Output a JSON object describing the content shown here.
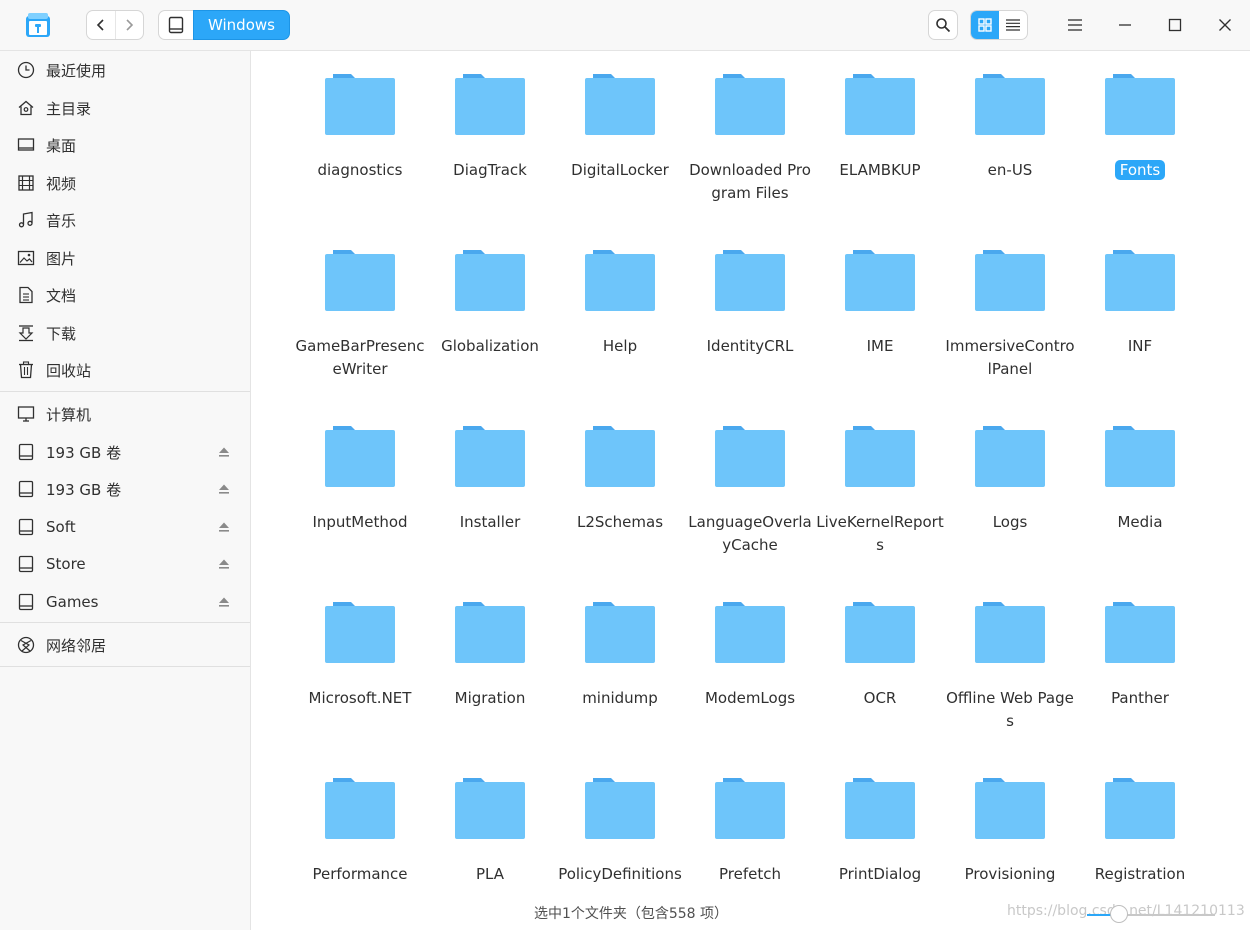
{
  "titlebar": {
    "app_icon": "file-manager-logo",
    "breadcrumb": {
      "home_icon": "drive-icon",
      "current": "Windows"
    },
    "view_mode": "icon-view"
  },
  "sidebar": {
    "quick": [
      {
        "label": "最近使用",
        "icon": "clock-icon"
      },
      {
        "label": "主目录",
        "icon": "home-icon"
      },
      {
        "label": "桌面",
        "icon": "desktop-icon"
      },
      {
        "label": "视频",
        "icon": "video-icon"
      },
      {
        "label": "音乐",
        "icon": "music-icon"
      },
      {
        "label": "图片",
        "icon": "picture-icon"
      },
      {
        "label": "文档",
        "icon": "document-icon"
      },
      {
        "label": "下载",
        "icon": "download-icon"
      },
      {
        "label": "回收站",
        "icon": "trash-icon"
      }
    ],
    "devices": [
      {
        "label": "计算机",
        "icon": "computer-icon"
      },
      {
        "label": "193 GB 卷",
        "icon": "drive-icon",
        "eject": true
      },
      {
        "label": "193 GB 卷",
        "icon": "drive-icon",
        "eject": true
      },
      {
        "label": "Soft",
        "icon": "drive-icon",
        "eject": true
      },
      {
        "label": "Store",
        "icon": "drive-icon",
        "eject": true
      },
      {
        "label": "Games",
        "icon": "drive-icon",
        "eject": true
      }
    ],
    "network": [
      {
        "label": "网络邻居",
        "icon": "network-icon"
      }
    ]
  },
  "files": [
    [
      "diagnostics",
      "DiagTrack",
      "DigitalLocker",
      "Downloaded Program Files",
      "ELAMBKUP",
      "en-US",
      "Fonts"
    ],
    [
      "GameBarPresenceWriter",
      "Globalization",
      "Help",
      "IdentityCRL",
      "IME",
      "ImmersiveControlPanel",
      "INF"
    ],
    [
      "InputMethod",
      "Installer",
      "L2Schemas",
      "LanguageOverlayCache",
      "LiveKernelReports",
      "Logs",
      "Media"
    ],
    [
      "Microsoft.NET",
      "Migration",
      "minidump",
      "ModemLogs",
      "OCR",
      "Offline Web Pages",
      "Panther"
    ],
    [
      "Performance",
      "PLA",
      "PolicyDefinitions",
      "Prefetch",
      "PrintDialog",
      "Provisioning",
      "Registration"
    ]
  ],
  "selected_file": "Fonts",
  "status": {
    "text": "选中1个文件夹（包含558 项）",
    "watermark": "https://blog.csdn.net/L141210113",
    "zoom_level": 0.25
  },
  "colors": {
    "accent": "#2ca7f8",
    "folder": "#6ec5fa",
    "folder_tab": "#4aa8ee"
  }
}
